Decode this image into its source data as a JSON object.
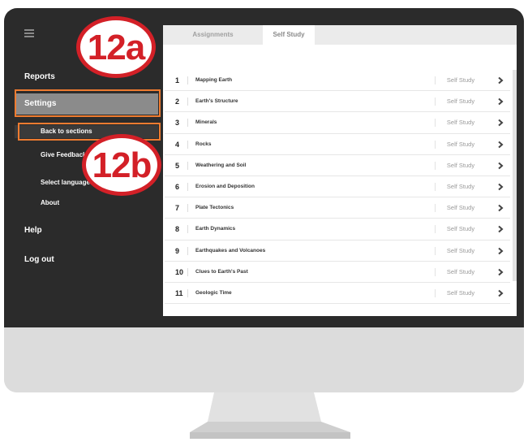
{
  "sidebar": {
    "items": [
      {
        "label": "Reports"
      },
      {
        "label": "Settings"
      },
      {
        "label": "Back to sections"
      },
      {
        "label": "Give Feedback"
      },
      {
        "label": "Select language"
      },
      {
        "label": "About"
      },
      {
        "label": "Help"
      },
      {
        "label": "Log out"
      }
    ]
  },
  "tabs": [
    {
      "label": "Assignments"
    },
    {
      "label": "Self Study"
    }
  ],
  "sections": [
    {
      "num": "1",
      "title": "Mapping Earth",
      "type": "Self Study"
    },
    {
      "num": "2",
      "title": "Earth's Structure",
      "type": "Self Study"
    },
    {
      "num": "3",
      "title": "Minerals",
      "type": "Self Study"
    },
    {
      "num": "4",
      "title": "Rocks",
      "type": "Self Study"
    },
    {
      "num": "5",
      "title": "Weathering and Soil",
      "type": "Self Study"
    },
    {
      "num": "6",
      "title": "Erosion and Deposition",
      "type": "Self Study"
    },
    {
      "num": "7",
      "title": "Plate Tectonics",
      "type": "Self Study"
    },
    {
      "num": "8",
      "title": "Earth Dynamics",
      "type": "Self Study"
    },
    {
      "num": "9",
      "title": "Earthquakes and Volcanoes",
      "type": "Self Study"
    },
    {
      "num": "10",
      "title": "Clues to Earth's Past",
      "type": "Self Study"
    },
    {
      "num": "11",
      "title": "Geologic Time",
      "type": "Self Study"
    }
  ],
  "callouts": {
    "a": "12a",
    "b": "12b"
  },
  "colors": {
    "highlight": "#ee7b30",
    "callout": "#d32027",
    "sidebar_bg": "#2b2b2b",
    "active_item": "#8b8b8b"
  }
}
